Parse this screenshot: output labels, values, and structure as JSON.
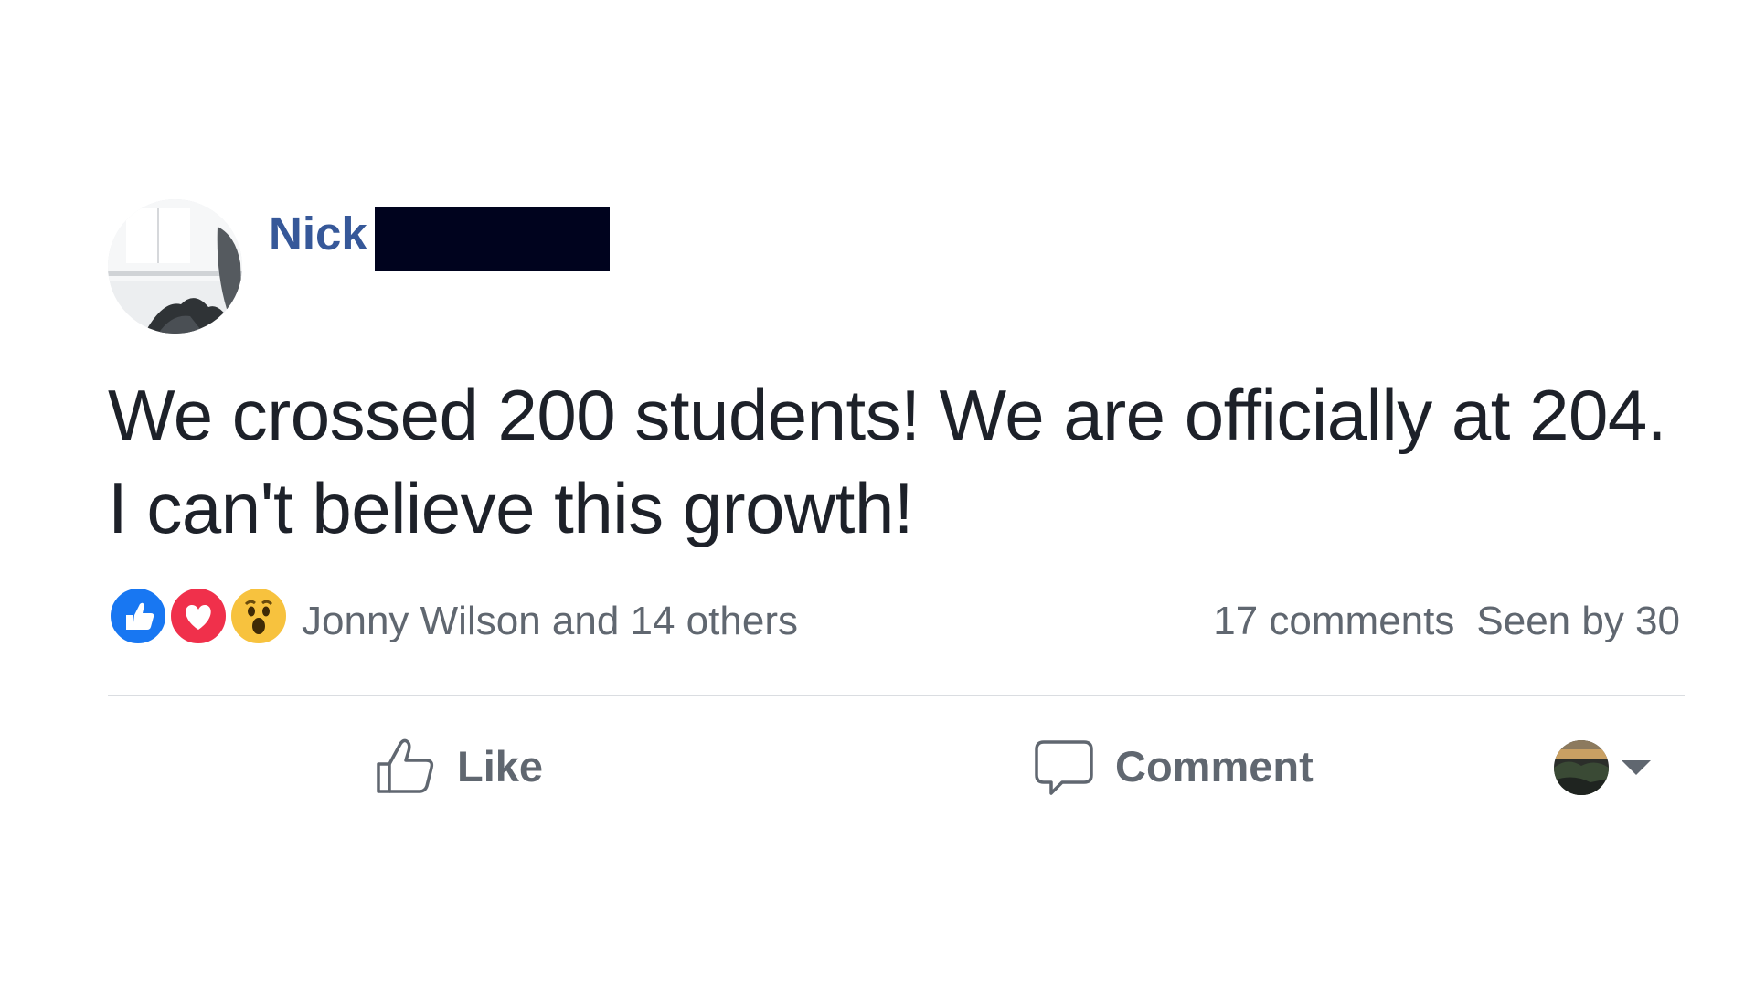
{
  "post": {
    "author_name": "Nick",
    "text": "We crossed 200 students! We are officially at 204. I can't believe this growth!",
    "reactions": {
      "icons": [
        "like-icon",
        "love-icon",
        "wow-icon"
      ],
      "summary": "Jonny Wilson and 14 others"
    },
    "stats": {
      "comments": "17 comments",
      "seen_by": "Seen by 30"
    },
    "actions": {
      "like_label": "Like",
      "comment_label": "Comment"
    },
    "colors": {
      "author_link": "#365899",
      "text": "#1d2129",
      "muted": "#606770",
      "like_blue": "#1877f2",
      "love_red": "#f0304b",
      "wow_yellow": "#f7c23e",
      "redaction": "#00031e"
    }
  }
}
